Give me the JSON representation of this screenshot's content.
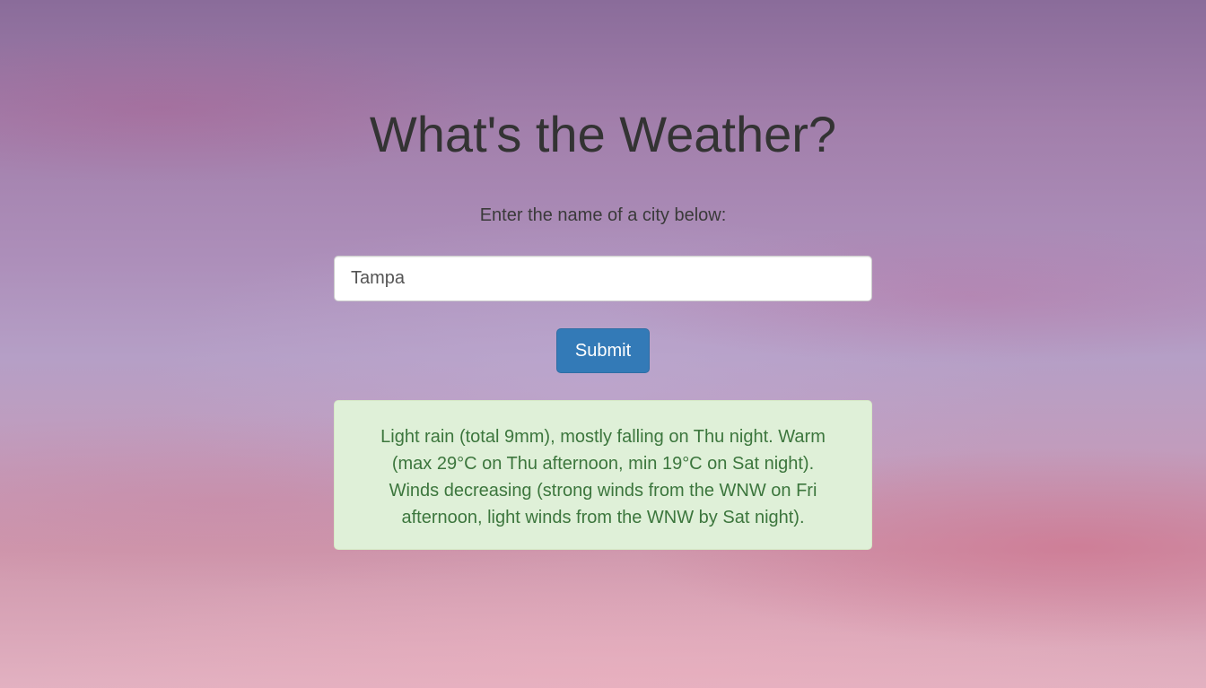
{
  "header": {
    "title": "What's the Weather?"
  },
  "form": {
    "prompt": "Enter the name of a city below:",
    "city_value": "Tampa",
    "city_placeholder": "",
    "submit_label": "Submit"
  },
  "result": {
    "message": "Light rain (total 9mm), mostly falling on Thu night. Warm (max 29°C on Thu afternoon, min 19°C on Sat night). Winds decreasing (strong winds from the WNW on Fri afternoon, light winds from the WNW by Sat night)."
  },
  "colors": {
    "button_primary": "#337ab7",
    "alert_success_bg": "#dff0d8",
    "alert_success_text": "#3c763d",
    "title_text": "#333333"
  }
}
